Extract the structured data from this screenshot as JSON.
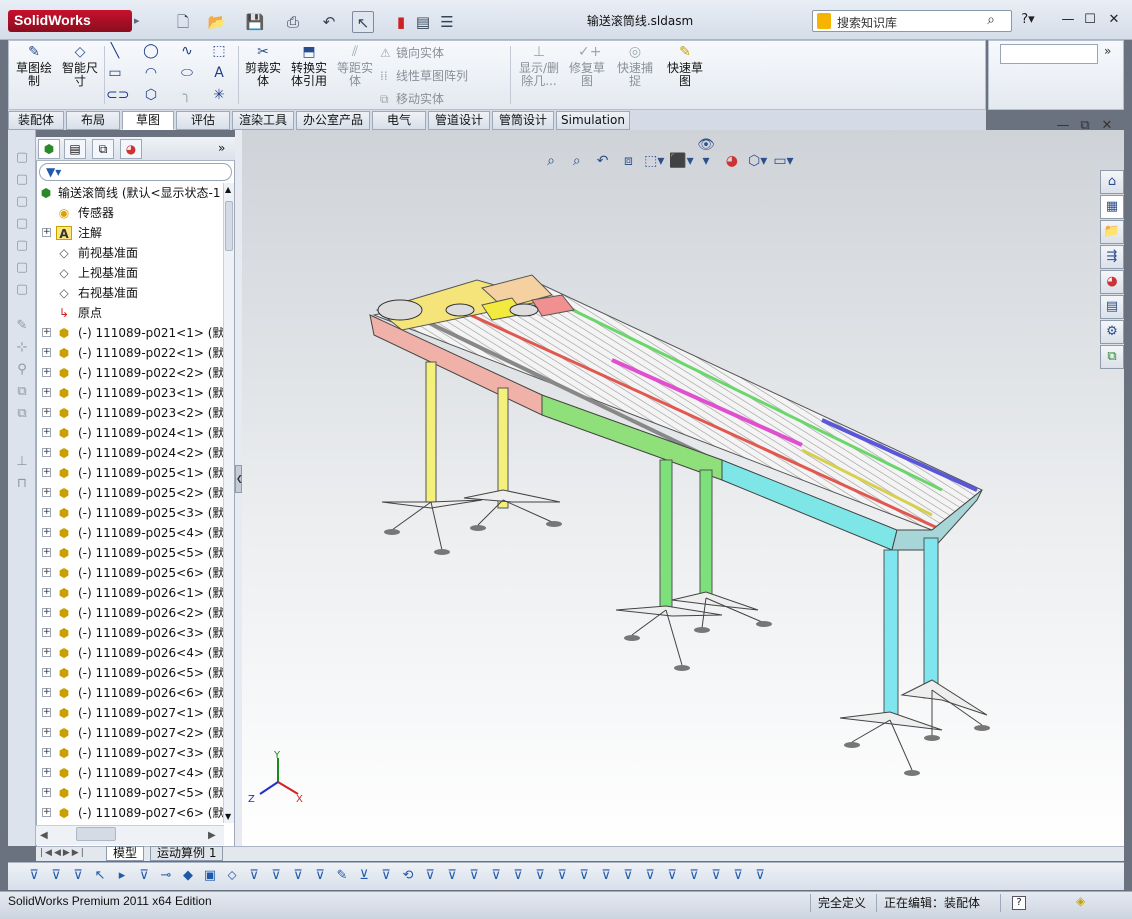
{
  "app": {
    "logo_text": "SolidWorks",
    "document_title": "输送滚筒线.sldasm",
    "search_placeholder": "搜索知识库"
  },
  "command_manager": {
    "sketch_label": "草图绘\n制",
    "smart_dim_label": "智能尺\n寸",
    "trim_label": "剪裁实\n体",
    "convert_label": "转换实\n体引用",
    "offset_label": "等距实\n体",
    "mirror_label": "镜向实体",
    "linear_pattern_label": "线性草图阵列",
    "move_label": "移动实体",
    "show_delete_label": "显示/删\n除几...",
    "repair_label": "修复草\n图",
    "quick_snap_label": "快速捕\n捉",
    "rapid_sketch_label": "快速草\n图"
  },
  "tabs": [
    {
      "label": "装配体"
    },
    {
      "label": "布局"
    },
    {
      "label": "草图"
    },
    {
      "label": "评估"
    },
    {
      "label": "渲染工具"
    },
    {
      "label": "办公室产品"
    },
    {
      "label": "电气"
    },
    {
      "label": "管道设计"
    },
    {
      "label": "管筒设计"
    },
    {
      "label": "Simulation"
    }
  ],
  "active_tab": "草图",
  "tree": {
    "root": "输送滚筒线  (默认<显示状态-1",
    "sensors": "传感器",
    "annotations": "注解",
    "front_plane": "前视基准面",
    "top_plane": "上视基准面",
    "right_plane": "右视基准面",
    "origin": "原点",
    "components": [
      "(-) 111089-p021<1> (默认",
      "(-) 111089-p022<1> (默认",
      "(-) 111089-p022<2> (默认",
      "(-) 111089-p023<1> (默认",
      "(-) 111089-p023<2> (默认",
      "(-) 111089-p024<1> (默认",
      "(-) 111089-p024<2> (默认",
      "(-) 111089-p025<1> (默认",
      "(-) 111089-p025<2> (默认",
      "(-) 111089-p025<3> (默认",
      "(-) 111089-p025<4> (默认",
      "(-) 111089-p025<5> (默认",
      "(-) 111089-p025<6> (默认",
      "(-) 111089-p026<1> (默认",
      "(-) 111089-p026<2> (默认",
      "(-) 111089-p026<3> (默认",
      "(-) 111089-p026<4> (默认",
      "(-) 111089-p026<5> (默认",
      "(-) 111089-p026<6> (默认",
      "(-) 111089-p027<1> (默认",
      "(-) 111089-p027<2> (默认",
      "(-) 111089-p027<3> (默认",
      "(-) 111089-p027<4> (默认",
      "(-) 111089-p027<5> (默认",
      "(-) 111089-p027<6> (默认"
    ]
  },
  "bottom_tabs": {
    "model": "模型",
    "motion": "运动算例 1"
  },
  "triad": {
    "x": "X",
    "y": "Y",
    "z": "Z"
  },
  "status": {
    "edition": "SolidWorks Premium 2011 x64 Edition",
    "definition": "完全定义",
    "editing": "正在编辑：装配体",
    "help": "?"
  },
  "colors": {
    "logo_red": "#c8102e",
    "frame_pink": "#f0b2a8",
    "frame_green": "#8fe07a",
    "frame_cyan": "#7fe6e8",
    "leg_yellow": "#f3f07c",
    "leg_green": "#7ee07a",
    "leg_cyan": "#7fe6f0",
    "rail_magenta": "#e04fcf",
    "rail_blue": "#5a57d8",
    "rail_red": "#e0584f"
  }
}
